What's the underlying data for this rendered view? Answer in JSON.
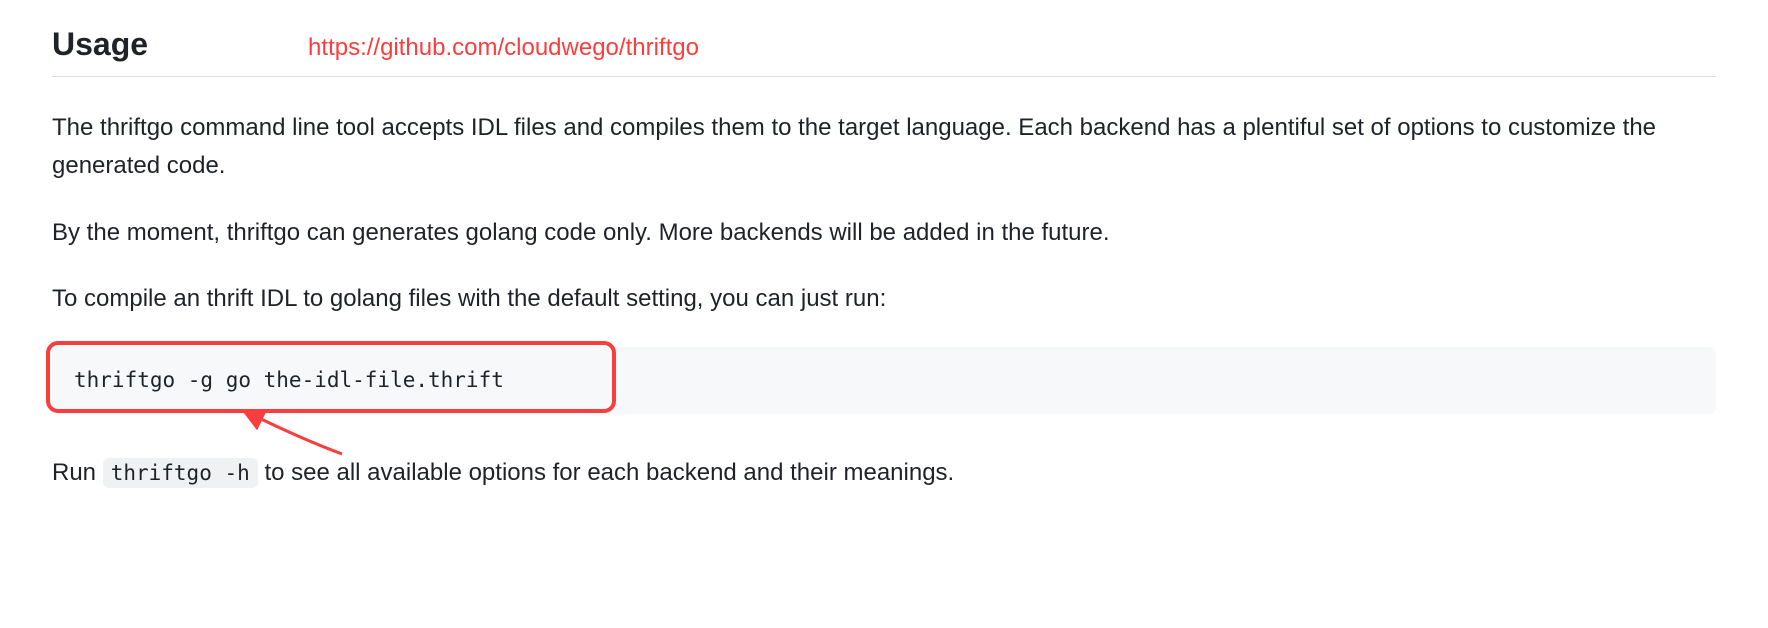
{
  "heading": "Usage",
  "annotation_url": "https://github.com/cloudwego/thriftgo",
  "paragraphs": {
    "p1": "The thriftgo command line tool accepts IDL files and compiles them to the target language. Each backend has a plentiful set of options to customize the generated code.",
    "p2": "By the moment, thriftgo can generates golang code only. More backends will be added in the future.",
    "p3": "To compile an thrift IDL to golang files with the default setting, you can just run:"
  },
  "code_block": "thriftgo -g go the-idl-file.thrift",
  "last_line": {
    "prefix": "Run ",
    "code": "thriftgo -h",
    "suffix": " to see all available options for each backend and their meanings."
  },
  "colors": {
    "annotation": "#fa3e3e",
    "text": "#1f2328",
    "code_bg": "#f6f8fa",
    "inline_code_bg": "#eff1f3",
    "border": "#d8dee4"
  }
}
